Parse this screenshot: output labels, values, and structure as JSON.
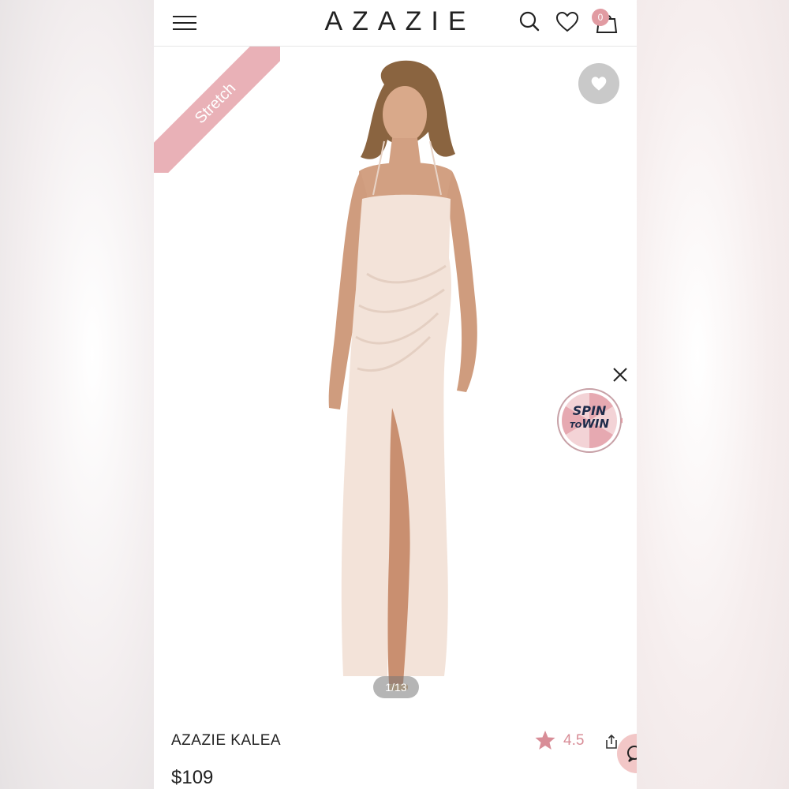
{
  "header": {
    "logo": "AZAZIE",
    "cart_count": "0"
  },
  "product_image": {
    "badge": "Stretch",
    "pager": "1/13"
  },
  "promo": {
    "spin_line1": "SPIN",
    "spin_line2_a": "TO",
    "spin_line2_b": "WIN"
  },
  "product": {
    "name": "AZAZIE KALEA",
    "rating": "4.5",
    "price": "$109"
  },
  "colors": {
    "accent_pink": "#e19ba2",
    "ribbon_pink": "#e9b1b7",
    "rating_pink": "#d88d97",
    "dress_color": "#f3e3d9"
  },
  "icons": [
    "hamburger-menu-icon",
    "search-icon",
    "heart-icon",
    "shopping-bag-icon",
    "favorite-heart-icon",
    "close-icon",
    "star-icon",
    "share-icon",
    "chat-icon"
  ]
}
